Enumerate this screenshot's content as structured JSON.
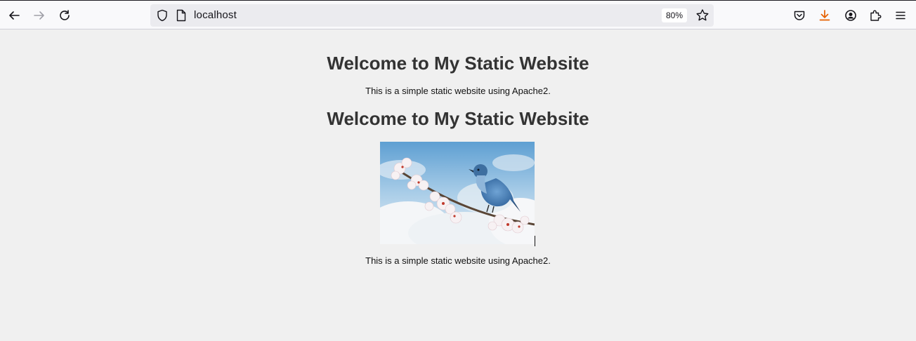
{
  "browser": {
    "url": "localhost",
    "zoom": "80%",
    "colors": {
      "download_accent": "#e66000",
      "toolbar_bg": "#f9f9fb",
      "urlbar_bg": "#ebebef"
    },
    "icons": [
      "back-arrow-icon",
      "forward-arrow-icon",
      "reload-icon",
      "shield-icon",
      "page-icon",
      "bookmark-star-icon",
      "pocket-icon",
      "download-icon",
      "account-icon",
      "extensions-icon",
      "menu-icon"
    ]
  },
  "page": {
    "heading_1": "Welcome to My Static Website",
    "paragraph_1": "This is a simple static website using Apache2.",
    "heading_2": "Welcome to My Static Website",
    "image_subject": "bird-on-blossom-branch",
    "paragraph_2": "This is a simple static website using Apache2."
  }
}
